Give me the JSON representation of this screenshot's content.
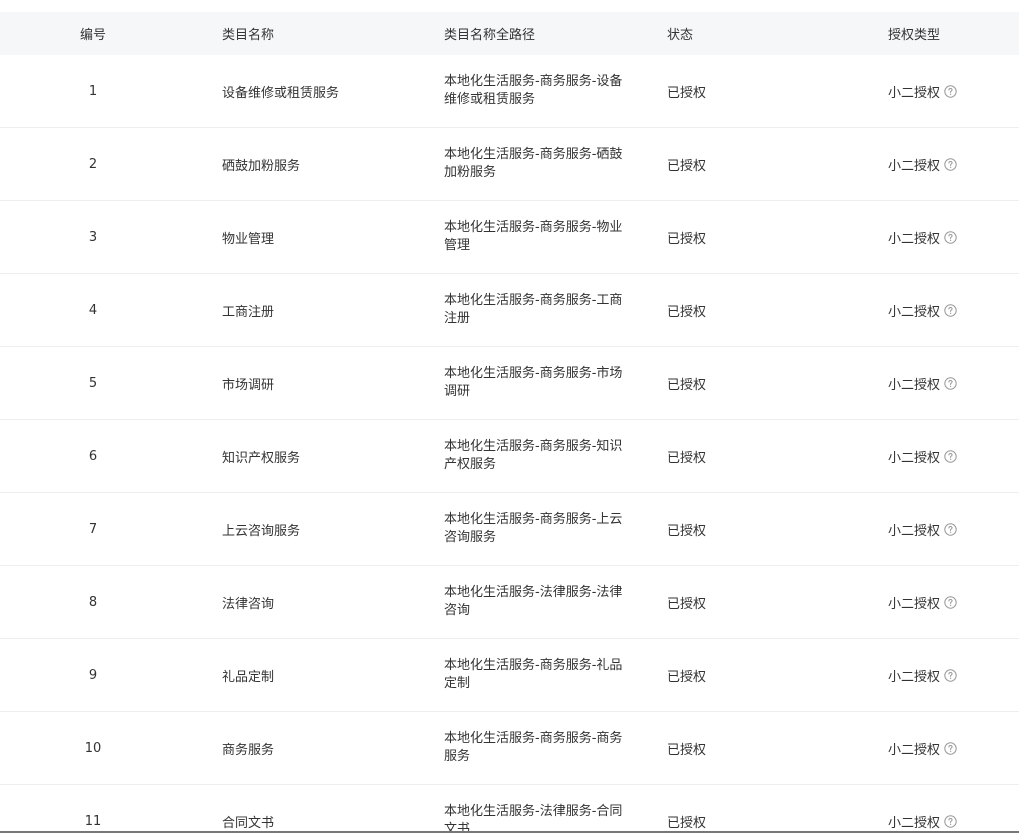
{
  "table": {
    "headers": {
      "id": "编号",
      "name": "类目名称",
      "path": "类目名称全路径",
      "status": "状态",
      "auth": "授权类型"
    },
    "rows": [
      {
        "id": "1",
        "name": "设备维修或租赁服务",
        "path": "本地化生活服务-商务服务-设备维修或租赁服务",
        "status": "已授权",
        "auth": "小二授权"
      },
      {
        "id": "2",
        "name": "硒鼓加粉服务",
        "path": "本地化生活服务-商务服务-硒鼓加粉服务",
        "status": "已授权",
        "auth": "小二授权"
      },
      {
        "id": "3",
        "name": "物业管理",
        "path": "本地化生活服务-商务服务-物业管理",
        "status": "已授权",
        "auth": "小二授权"
      },
      {
        "id": "4",
        "name": "工商注册",
        "path": "本地化生活服务-商务服务-工商注册",
        "status": "已授权",
        "auth": "小二授权"
      },
      {
        "id": "5",
        "name": "市场调研",
        "path": "本地化生活服务-商务服务-市场调研",
        "status": "已授权",
        "auth": "小二授权"
      },
      {
        "id": "6",
        "name": "知识产权服务",
        "path": "本地化生活服务-商务服务-知识产权服务",
        "status": "已授权",
        "auth": "小二授权"
      },
      {
        "id": "7",
        "name": "上云咨询服务",
        "path": "本地化生活服务-商务服务-上云咨询服务",
        "status": "已授权",
        "auth": "小二授权"
      },
      {
        "id": "8",
        "name": "法律咨询",
        "path": "本地化生活服务-法律服务-法律咨询",
        "status": "已授权",
        "auth": "小二授权"
      },
      {
        "id": "9",
        "name": "礼品定制",
        "path": "本地化生活服务-商务服务-礼品定制",
        "status": "已授权",
        "auth": "小二授权"
      },
      {
        "id": "10",
        "name": "商务服务",
        "path": "本地化生活服务-商务服务-商务服务",
        "status": "已授权",
        "auth": "小二授权"
      },
      {
        "id": "11",
        "name": "合同文书",
        "path": "本地化生活服务-法律服务-合同文书",
        "status": "已授权",
        "auth": "小二授权"
      }
    ]
  },
  "icons": {
    "help": "question-circle-icon"
  },
  "colors": {
    "header_bg": "#f6f7f9",
    "text": "#333333",
    "icon": "#999999",
    "divider": "#eeeeee"
  }
}
